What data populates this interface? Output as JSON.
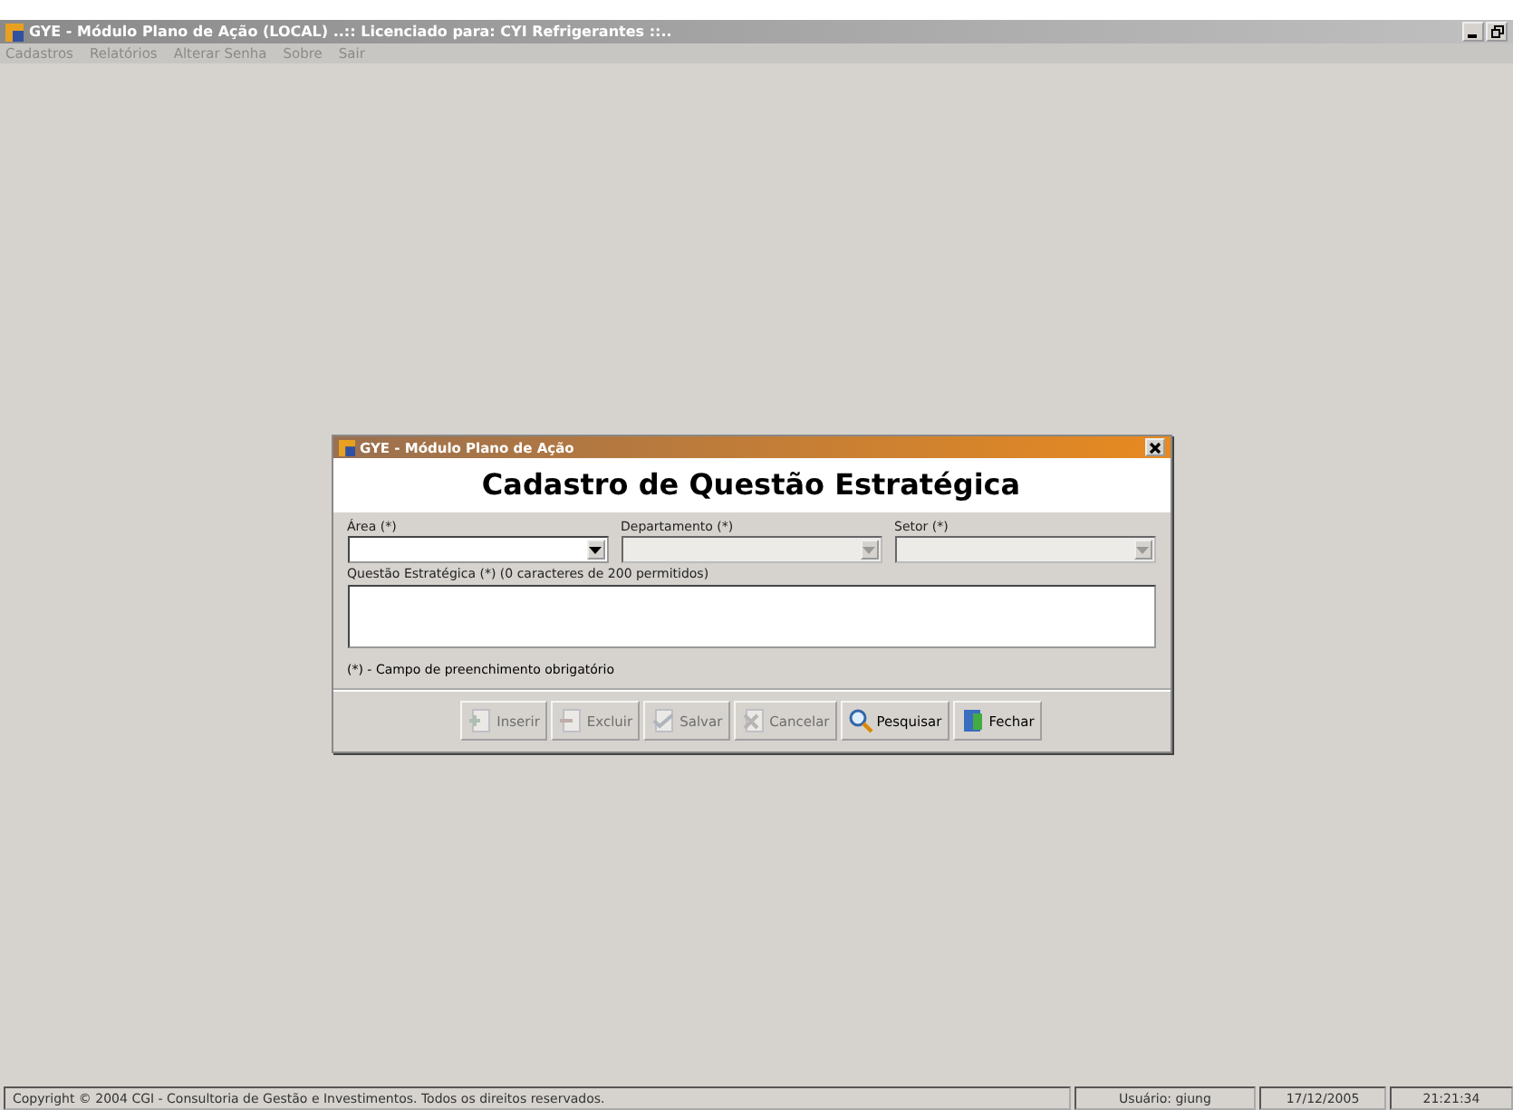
{
  "window": {
    "title": "GYE - Módulo Plano de Ação (LOCAL) ..:: Licenciado para: CYI Refrigerantes ::.."
  },
  "menu": [
    "Cadastros",
    "Relatórios",
    "Alterar Senha",
    "Sobre",
    "Sair"
  ],
  "dialog": {
    "title": "GYE - Módulo Plano de Ação",
    "heading": "Cadastro de Questão Estratégica",
    "combos": [
      {
        "label": "Área (*)",
        "disabled": false
      },
      {
        "label": "Departamento (*)",
        "disabled": true
      },
      {
        "label": "Setor (*)",
        "disabled": true
      }
    ],
    "memo_label": "Questão Estratégica (*) (0 caracteres de 200 permitidos)",
    "note": "(*) - Campo de preenchimento obrigatório",
    "buttons": [
      {
        "label": "Inserir",
        "kind": "insert",
        "disabled": true
      },
      {
        "label": "Excluir",
        "kind": "delete",
        "disabled": true
      },
      {
        "label": "Salvar",
        "kind": "save",
        "disabled": true
      },
      {
        "label": "Cancelar",
        "kind": "cancel",
        "disabled": true
      },
      {
        "label": "Pesquisar",
        "kind": "search",
        "disabled": false
      },
      {
        "label": "Fechar",
        "kind": "close",
        "disabled": false
      }
    ]
  },
  "status_bar": [
    "Copyright © 2004 CGI - Consultoria de Gestão e Investimentos. Todos os direitos reservados.",
    "Usuário: giung",
    "17/12/2005",
    "21:21:34"
  ]
}
